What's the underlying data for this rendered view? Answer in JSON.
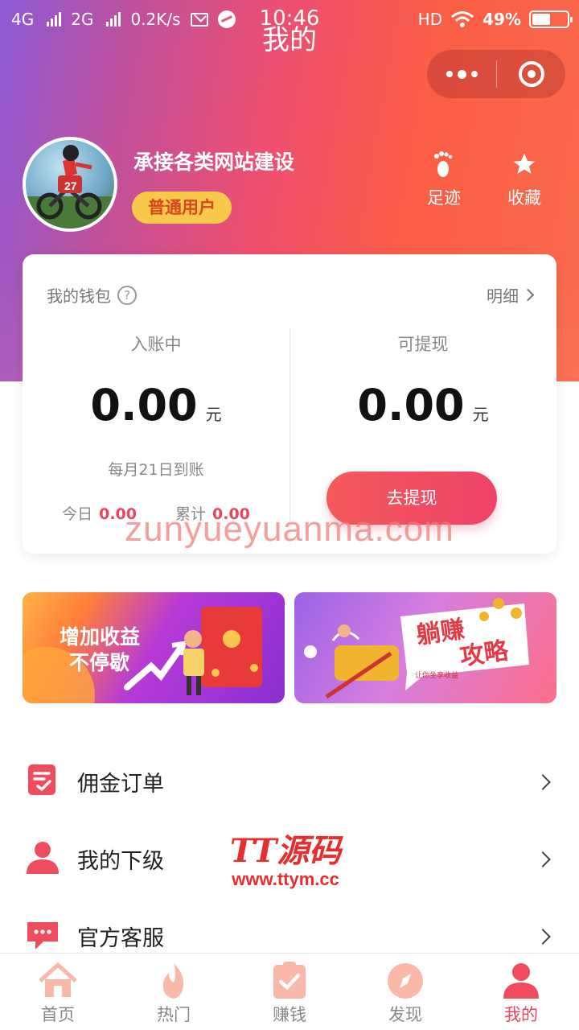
{
  "status_bar": {
    "network1": "4G",
    "network2": "2G",
    "speed": "0.2K/s",
    "time": "10:46",
    "hd": "HD",
    "battery": "49%"
  },
  "page": {
    "title": "我的"
  },
  "profile": {
    "name": "承接各类网站建设",
    "badge": "普通用户",
    "footprint_label": "足迹",
    "favorites_label": "收藏"
  },
  "wallet": {
    "title": "我的钱包",
    "help": "?",
    "detail_label": "明细",
    "pending": {
      "label": "入账中",
      "amount": "0.00",
      "unit": "元",
      "note": "每月21日到账",
      "today_label": "今日",
      "today_value": "0.00",
      "total_label": "累计",
      "total_value": "0.00"
    },
    "withdrawable": {
      "label": "可提现",
      "amount": "0.00",
      "unit": "元",
      "button": "去提现"
    }
  },
  "watermark": "zunyueyuanma.com",
  "banners": {
    "left_line1": "增加收益",
    "left_line2": "不停歇",
    "right_line1": "躺赚",
    "right_line2": "攻略",
    "right_caption": "让你坐享收益"
  },
  "menu": [
    {
      "label": "佣金订单"
    },
    {
      "label": "我的下级"
    },
    {
      "label": "官方客服"
    }
  ],
  "tt_watermark": {
    "big": "TT源码",
    "small": "www.ttym.cc"
  },
  "tabs": [
    {
      "label": "首页"
    },
    {
      "label": "热门"
    },
    {
      "label": "赚钱"
    },
    {
      "label": "发现"
    },
    {
      "label": "我的"
    }
  ],
  "colors": {
    "accent": "#e8455f",
    "badge": "#f9c94c",
    "gradient_start": "#8c5ad6",
    "gradient_end": "#fa6a4c"
  }
}
